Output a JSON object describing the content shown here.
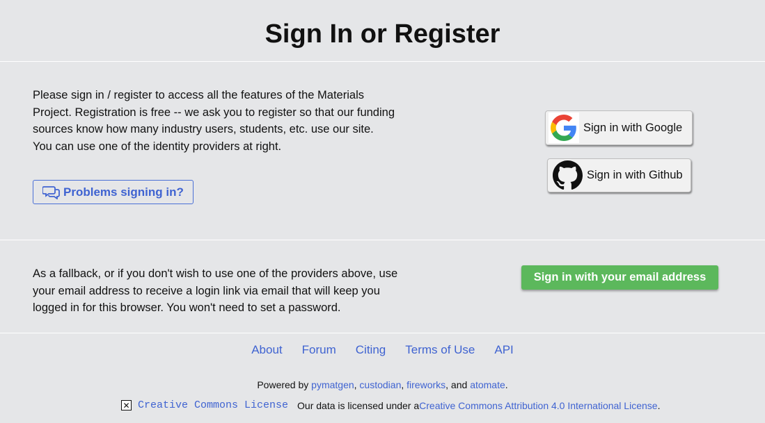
{
  "page": {
    "title": "Sign In or Register"
  },
  "intro": {
    "text": "Please sign in / register to access all the features of the Materials Project. Registration is free -- we ask you to register so that our funding sources know how many industry users, students, etc. use our site. You can use one of the identity providers at right.",
    "problems_label": "Problems signing in?"
  },
  "providers": {
    "google_label": "Sign in with Google",
    "github_label": "Sign in with Github"
  },
  "fallback": {
    "text": "As a fallback, or if you don't wish to use one of the providers above, use your email address to receive a login link via email that will keep you logged in for this browser. You won't need to set a password.",
    "email_button_label": "Sign in with your email address"
  },
  "footer": {
    "links": [
      "About",
      "Forum",
      "Citing",
      "Terms of Use",
      "API"
    ],
    "powered_prefix": "Powered by ",
    "powered_links": [
      "pymatgen",
      "custodian",
      "fireworks",
      "atomate"
    ],
    "sep1": ", ",
    "sep2": ", ",
    "sep3": ", and ",
    "powered_suffix": ".",
    "cc_image_alt": "Creative Commons License",
    "license_prefix": "Our data is licensed under a ",
    "license_link": "Creative Commons Attribution 4.0 International License",
    "license_suffix": "."
  },
  "colors": {
    "background": "#e5e6e8",
    "link": "#3f63d1",
    "email_button": "#5cb85c"
  },
  "icons": {
    "problems": "chat-bubbles-icon",
    "google": "google-g-logo-icon",
    "github": "github-octocat-icon",
    "broken_image": "broken-image-icon"
  }
}
